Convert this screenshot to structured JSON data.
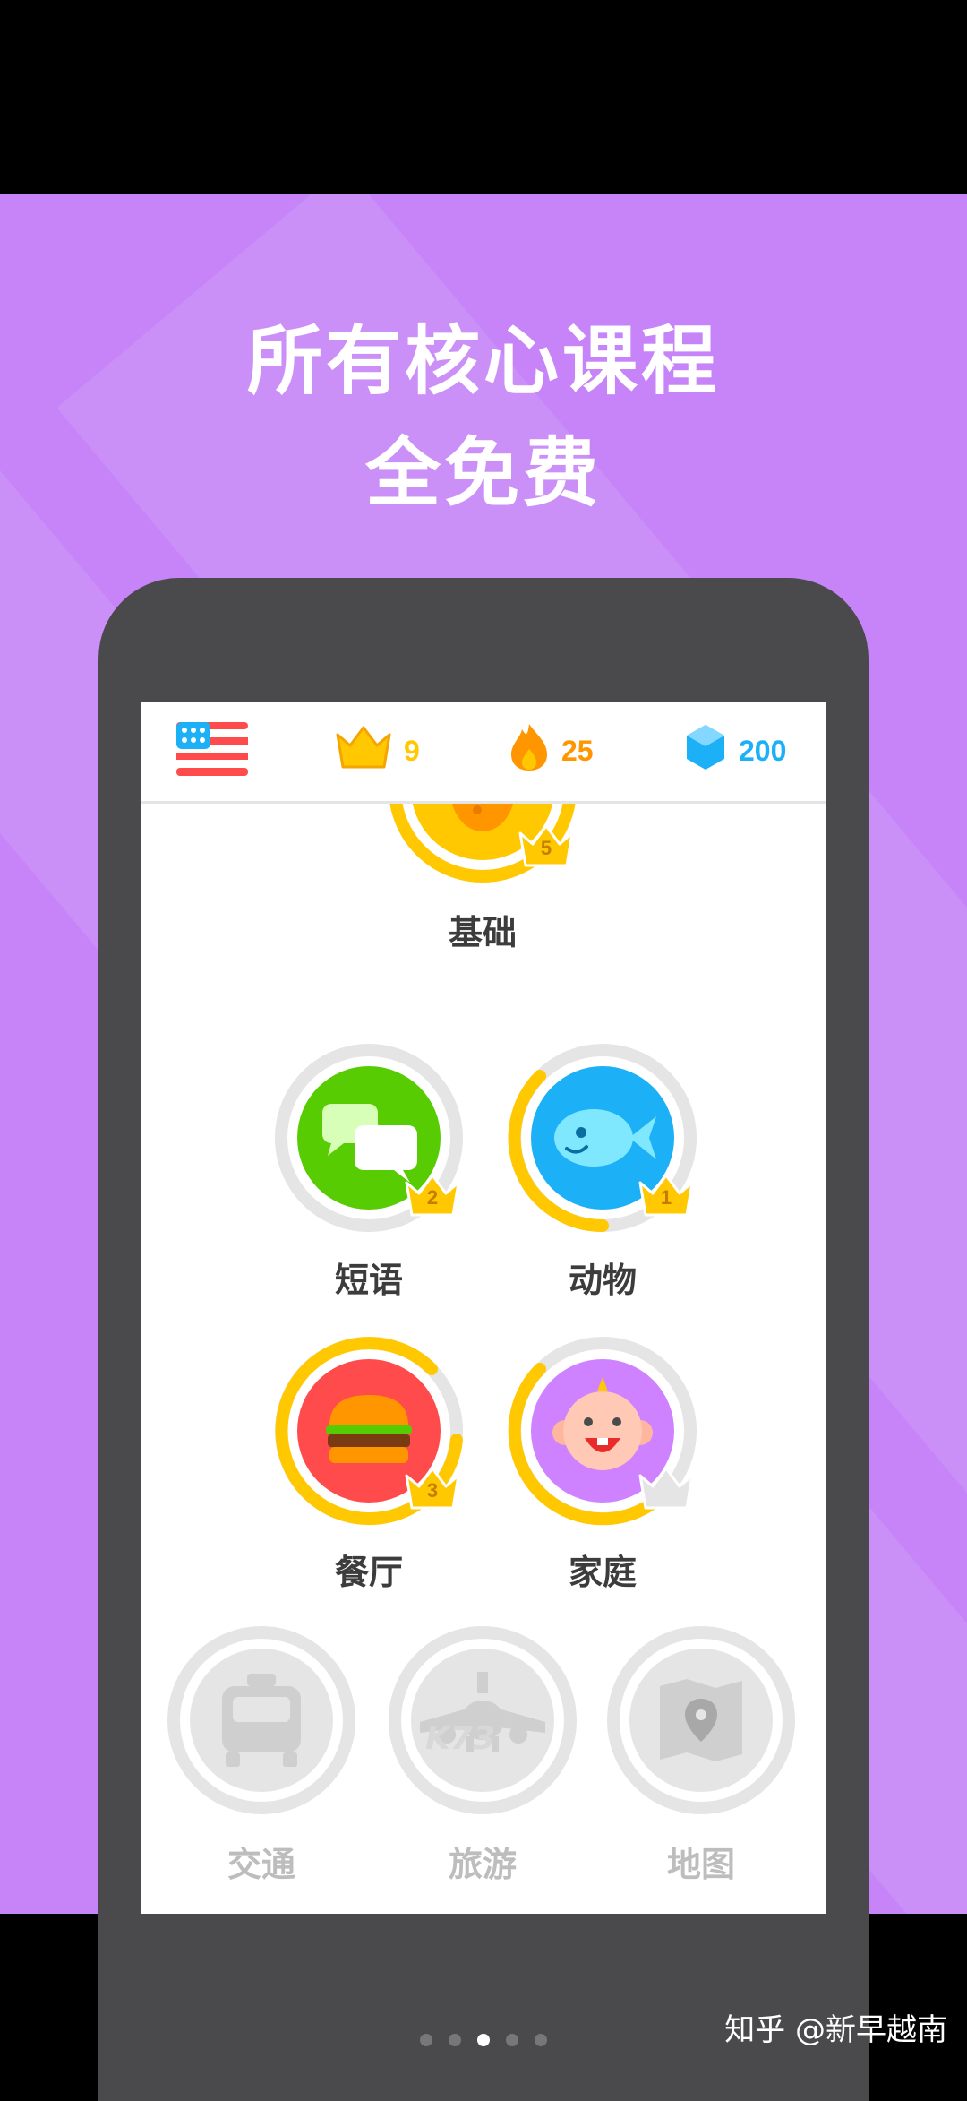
{
  "promo": {
    "headline_line1": "所有核心课程",
    "headline_line2": "全免费",
    "background_color": "#c684f8"
  },
  "stats_bar": {
    "flag_icon": "us-flag-icon",
    "crowns": "9",
    "streak": "25",
    "gems": "200",
    "crown_color": "#ffc800",
    "streak_color": "#ff9600",
    "gem_color": "#1cb0f6"
  },
  "skills": [
    {
      "label": "基础",
      "icon": "egg-icon",
      "level": "5",
      "progress": 1.0
    },
    {
      "label": "短语",
      "icon": "chat-bubbles-icon",
      "level": "2",
      "progress": 0.0
    },
    {
      "label": "动物",
      "icon": "fish-icon",
      "level": "1",
      "progress": 0.45
    },
    {
      "label": "餐厅",
      "icon": "burger-icon",
      "level": "3",
      "progress": 0.65
    },
    {
      "label": "家庭",
      "icon": "baby-icon",
      "level": "",
      "progress": 0.55
    },
    {
      "label": "交通",
      "icon": "taxi-icon",
      "locked": true
    },
    {
      "label": "旅游",
      "icon": "airplane-icon",
      "locked": true
    },
    {
      "label": "地图",
      "icon": "map-pin-icon",
      "locked": true
    }
  ],
  "watermark_k73": "K73",
  "pager": {
    "count": 5,
    "active_index": 2
  },
  "watermark": "知乎 @新早越南"
}
